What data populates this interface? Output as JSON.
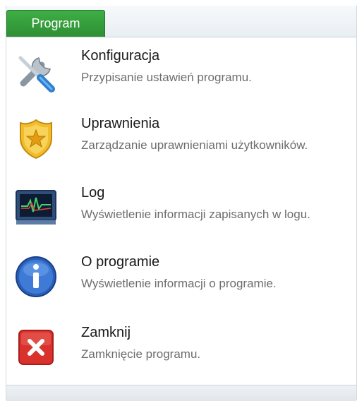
{
  "tabs": {
    "program_label": "Program"
  },
  "menu": {
    "items": [
      {
        "title": "Konfiguracja",
        "description": "Przypisanie ustawień programu.",
        "icon": "tools-icon"
      },
      {
        "title": "Uprawnienia",
        "description": "Zarządzanie uprawnieniami użytkowników.",
        "icon": "badge-icon"
      },
      {
        "title": "Log",
        "description": "Wyświetlenie informacji zapisanych w logu.",
        "icon": "log-monitor-icon"
      },
      {
        "title": "O programie",
        "description": "Wyświetlenie informacji o programie.",
        "icon": "info-icon"
      },
      {
        "title": "Zamknij",
        "description": "Zamknięcie programu.",
        "icon": "close-icon"
      }
    ]
  },
  "colors": {
    "tab_green": "#3fae45",
    "close_red": "#d9322c",
    "info_blue": "#2a5fb8"
  }
}
